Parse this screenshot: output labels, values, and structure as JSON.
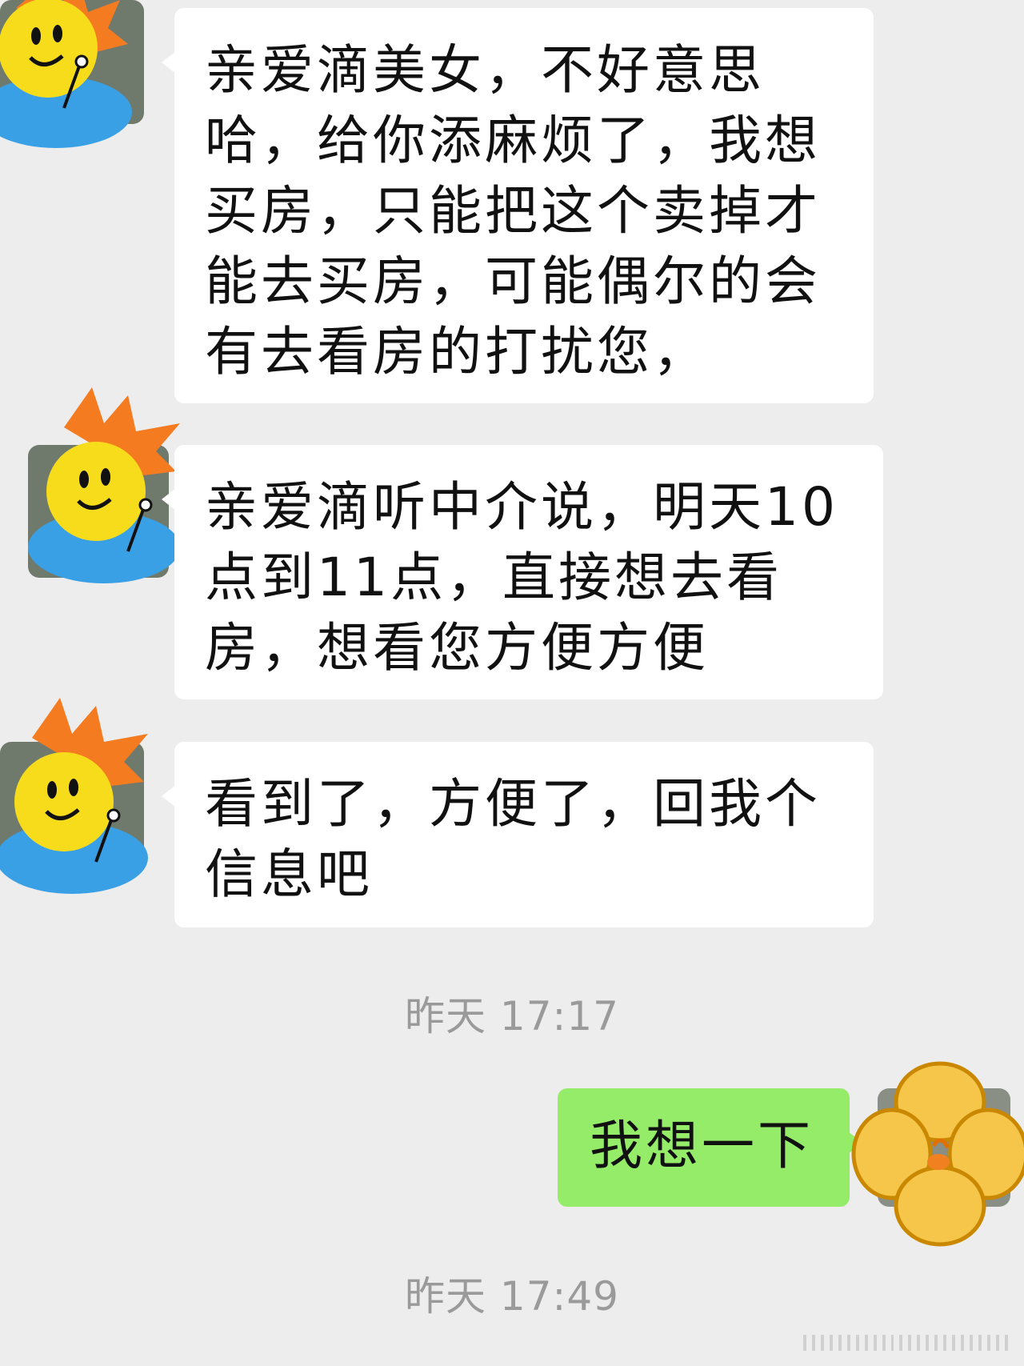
{
  "messages": [
    {
      "side": "in",
      "text": "亲爱滴美女，不好意思哈，给你添麻烦了，我想买房，只能把这个卖掉才能去买房，可能偶尔的会有去看房的打扰您，"
    },
    {
      "side": "in",
      "text": "亲爱滴听中介说，明天10点到11点，直接想去看房，想看您方便方便"
    },
    {
      "side": "in",
      "text": "看到了，方便了，回我个信息吧"
    },
    {
      "side": "out",
      "text": "我想一下"
    }
  ],
  "timestamps": [
    "昨天 17:17",
    "昨天 17:49"
  ],
  "colors": {
    "background": "#ededed",
    "incoming_bubble": "#ffffff",
    "outgoing_bubble": "#95ec69",
    "timestamp_text": "#9a9a9a"
  },
  "avatars": {
    "contact": "cartoon-boy-icon",
    "self": "flower-icon"
  }
}
